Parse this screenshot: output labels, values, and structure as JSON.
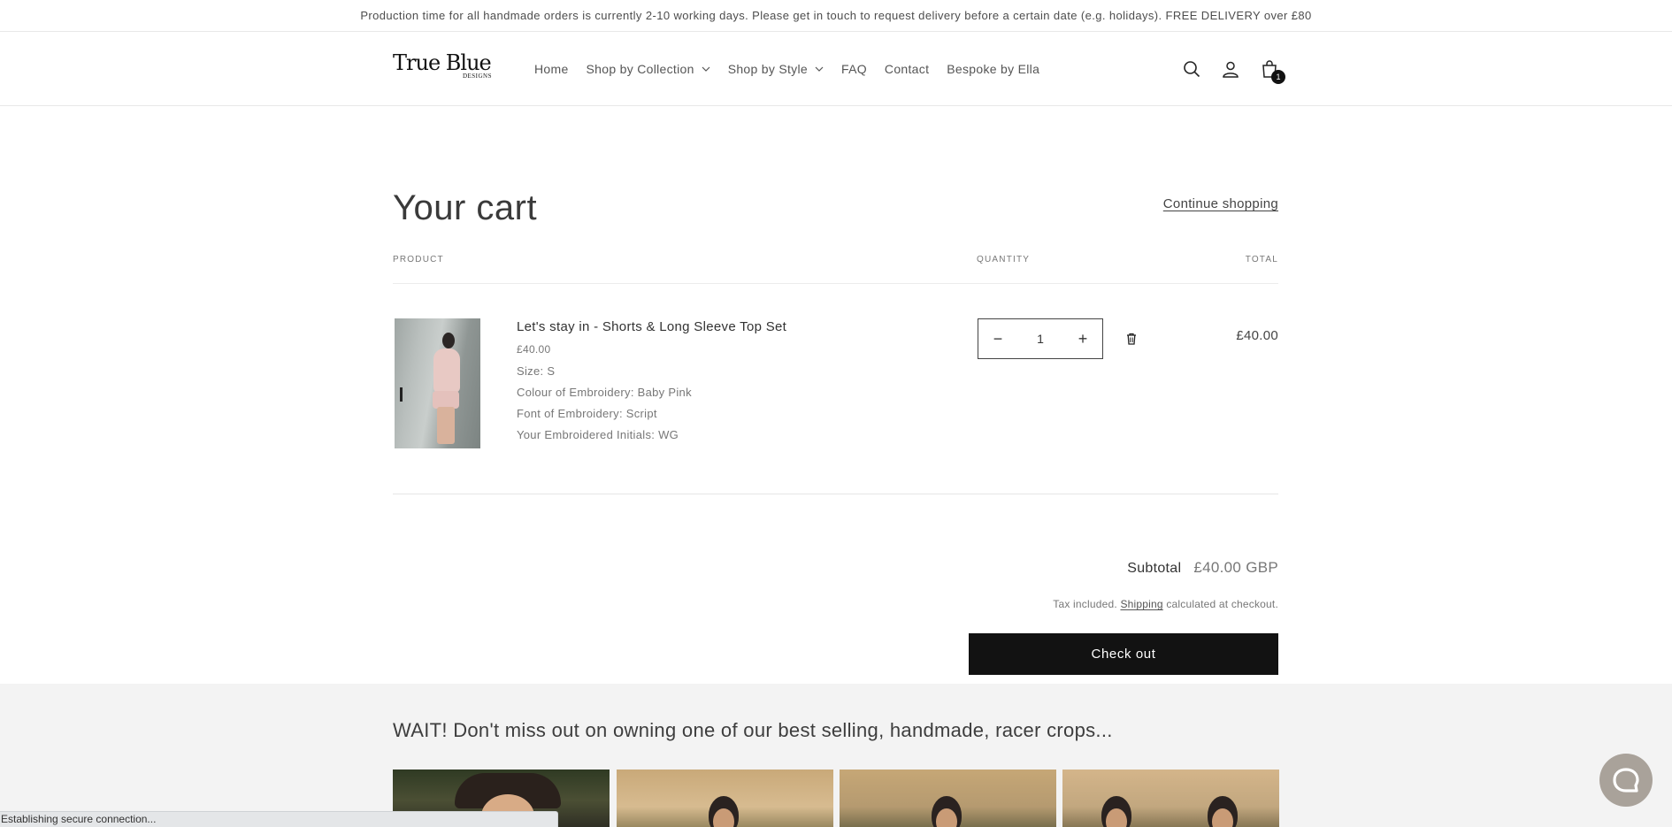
{
  "announcement": "Production time for all handmade orders is currently 2-10 working days. Please get in touch to request delivery before a certain date (e.g. holidays). FREE DELIVERY over £80",
  "logo": {
    "main": "True Blue",
    "sub": "DESIGNS"
  },
  "nav": [
    {
      "label": "Home",
      "dropdown": false
    },
    {
      "label": "Shop by Collection",
      "dropdown": true
    },
    {
      "label": "Shop by Style",
      "dropdown": true
    },
    {
      "label": "FAQ",
      "dropdown": false
    },
    {
      "label": "Contact",
      "dropdown": false
    },
    {
      "label": "Bespoke by Ella",
      "dropdown": false
    }
  ],
  "header_icons": {
    "search": "search-icon",
    "account": "account-icon",
    "cart": "cart-bag-icon",
    "cart_count": "1"
  },
  "cart": {
    "title": "Your cart",
    "continue_label": "Continue shopping",
    "columns": {
      "product": "PRODUCT",
      "quantity": "QUANTITY",
      "total": "TOTAL"
    },
    "item": {
      "name": "Let's stay in - Shorts & Long Sleeve Top Set",
      "price": "£40.00",
      "options": [
        "Size: S",
        "Colour of Embroidery: Baby Pink",
        "Font of Embroidery: Script",
        "Your Embroidered Initials: WG"
      ],
      "quantity": "1",
      "minus": "−",
      "plus": "+",
      "line_total": "£40.00"
    },
    "subtotal_label": "Subtotal",
    "subtotal_value": "£40.00 GBP",
    "tax_prefix": "Tax included.",
    "shipping_link": "Shipping",
    "tax_suffix": "calculated at checkout.",
    "checkout_label": "Check out"
  },
  "recommendations": {
    "title": "WAIT! Don't miss out on owning one of our best selling, handmade, racer crops..."
  },
  "status_bar": "Establishing secure connection...",
  "colors": {
    "button": "#121212",
    "recs_bg": "#f3f3f3",
    "chat": "#a9a29a"
  }
}
